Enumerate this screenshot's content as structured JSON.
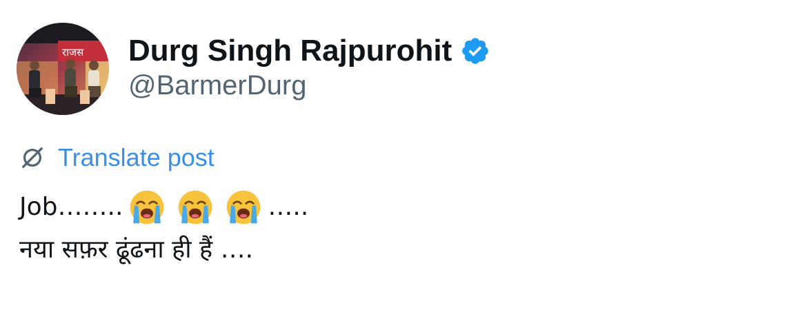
{
  "author": {
    "display_name": "Durg Singh Rajpurohit",
    "handle": "@BarmerDurg",
    "verified": true,
    "verified_color": "#1d9bf0",
    "avatar_sign_text": "राजस"
  },
  "translate": {
    "label": "Translate post",
    "icon": "globe-slash-icon",
    "color": "#3a8ee6"
  },
  "post": {
    "line1_prefix": "Job……..",
    "line1_suffix": "…..",
    "emojis": [
      "loudly-crying-face-icon",
      "loudly-crying-face-icon",
      "loudly-crying-face-icon"
    ],
    "line2": "नया सफ़र ढूंढना ही हैं …."
  }
}
